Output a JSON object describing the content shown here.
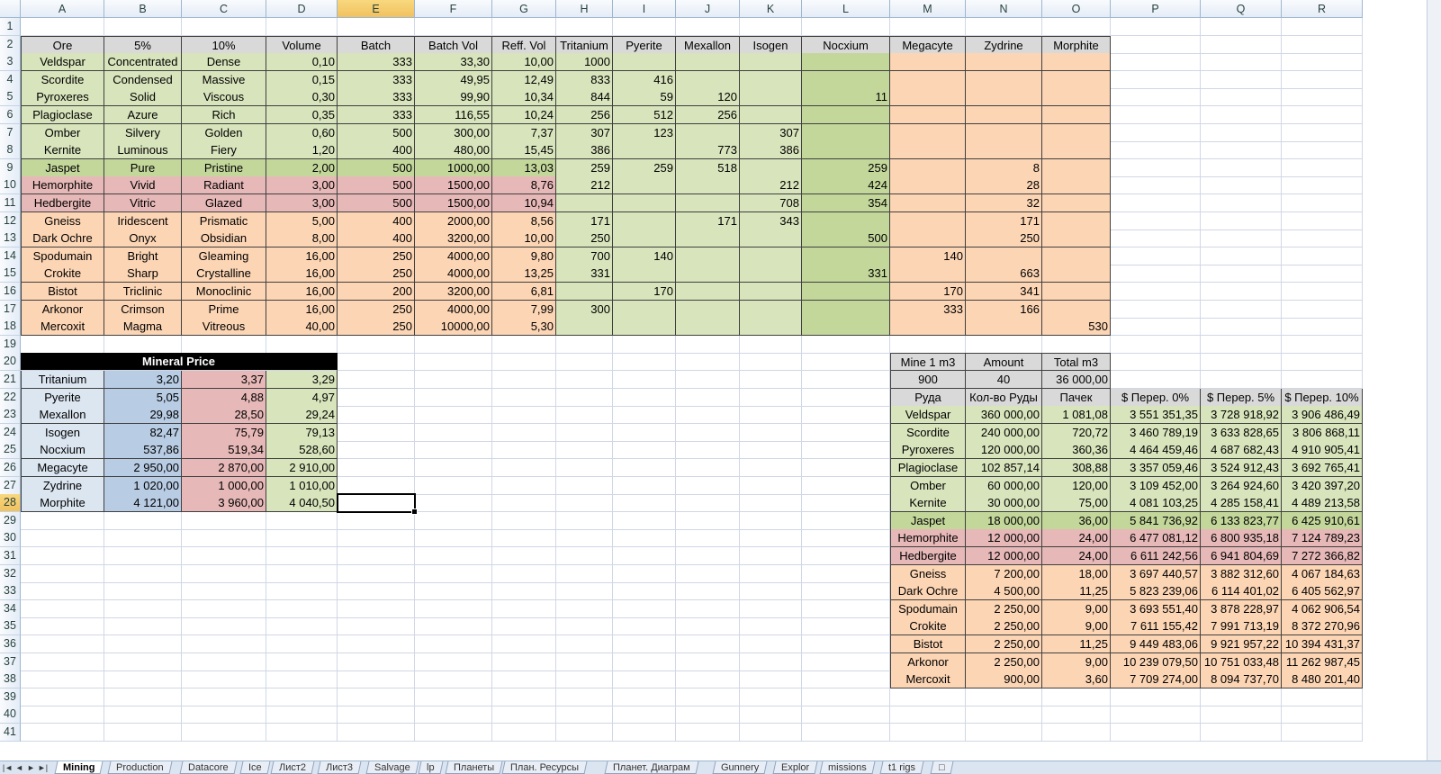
{
  "columns": [
    "A",
    "B",
    "C",
    "D",
    "E",
    "F",
    "G",
    "H",
    "I",
    "J",
    "K",
    "L",
    "M",
    "N",
    "O",
    "P",
    "Q",
    "R"
  ],
  "rows": [
    "1",
    "2",
    "3",
    "4",
    "5",
    "6",
    "7",
    "8",
    "9",
    "10",
    "11",
    "12",
    "13",
    "14",
    "15",
    "16",
    "17",
    "18",
    "19",
    "20",
    "21",
    "22",
    "23",
    "24",
    "25",
    "26",
    "27",
    "28",
    "29",
    "30",
    "31",
    "32",
    "33",
    "34",
    "35",
    "36",
    "37",
    "38",
    "39",
    "40",
    "41"
  ],
  "selected_cell": "E28",
  "colors": {
    "green": "#d8e4bc",
    "green_dark": "#c4d79b",
    "red": "#e6b8b7",
    "orange": "#fcd5b4",
    "header_gray": "#d9d9d9",
    "blue": "#b8cce4",
    "black": "#000000"
  },
  "ore_table": {
    "headers": [
      "Ore",
      "5%",
      "10%",
      "Volume",
      "Batch",
      "Batch Vol",
      "Reff. Vol",
      "Tritanium",
      "Pyerite",
      "Mexallon",
      "Isogen",
      "Nocxium",
      "Megacyte",
      "Zydrine",
      "Morphite"
    ],
    "rows": [
      [
        "Veldspar",
        "Concentrated",
        "Dense",
        "0,10",
        "333",
        "33,30",
        "10,00",
        "1000",
        "",
        "",
        "",
        "",
        "",
        "",
        ""
      ],
      [
        "Scordite",
        "Condensed",
        "Massive",
        "0,15",
        "333",
        "49,95",
        "12,49",
        "833",
        "416",
        "",
        "",
        "",
        "",
        "",
        ""
      ],
      [
        "Pyroxeres",
        "Solid",
        "Viscous",
        "0,30",
        "333",
        "99,90",
        "10,34",
        "844",
        "59",
        "120",
        "",
        "11",
        "",
        "",
        ""
      ],
      [
        "Plagioclase",
        "Azure",
        "Rich",
        "0,35",
        "333",
        "116,55",
        "10,24",
        "256",
        "512",
        "256",
        "",
        "",
        "",
        "",
        ""
      ],
      [
        "Omber",
        "Silvery",
        "Golden",
        "0,60",
        "500",
        "300,00",
        "7,37",
        "307",
        "123",
        "",
        "307",
        "",
        "",
        "",
        ""
      ],
      [
        "Kernite",
        "Luminous",
        "Fiery",
        "1,20",
        "400",
        "480,00",
        "15,45",
        "386",
        "",
        "773",
        "386",
        "",
        "",
        "",
        ""
      ],
      [
        "Jaspet",
        "Pure",
        "Pristine",
        "2,00",
        "500",
        "1000,00",
        "13,03",
        "259",
        "259",
        "518",
        "",
        "259",
        "",
        "8",
        ""
      ],
      [
        "Hemorphite",
        "Vivid",
        "Radiant",
        "3,00",
        "500",
        "1500,00",
        "8,76",
        "212",
        "",
        "",
        "212",
        "424",
        "",
        "28",
        ""
      ],
      [
        "Hedbergite",
        "Vitric",
        "Glazed",
        "3,00",
        "500",
        "1500,00",
        "10,94",
        "",
        "",
        "",
        "708",
        "354",
        "",
        "32",
        ""
      ],
      [
        "Gneiss",
        "Iridescent",
        "Prismatic",
        "5,00",
        "400",
        "2000,00",
        "8,56",
        "171",
        "",
        "171",
        "343",
        "",
        "",
        "171",
        ""
      ],
      [
        "Dark Ochre",
        "Onyx",
        "Obsidian",
        "8,00",
        "400",
        "3200,00",
        "10,00",
        "250",
        "",
        "",
        "",
        "500",
        "",
        "250",
        ""
      ],
      [
        "Spodumain",
        "Bright",
        "Gleaming",
        "16,00",
        "250",
        "4000,00",
        "9,80",
        "700",
        "140",
        "",
        "",
        "",
        "140",
        "",
        ""
      ],
      [
        "Crokite",
        "Sharp",
        "Crystalline",
        "16,00",
        "250",
        "4000,00",
        "13,25",
        "331",
        "",
        "",
        "",
        "331",
        "",
        "663",
        ""
      ],
      [
        "Bistot",
        "Triclinic",
        "Monoclinic",
        "16,00",
        "200",
        "3200,00",
        "6,81",
        "",
        "170",
        "",
        "",
        "",
        "170",
        "341",
        ""
      ],
      [
        "Arkonor",
        "Crimson",
        "Prime",
        "16,00",
        "250",
        "4000,00",
        "7,99",
        "300",
        "",
        "",
        "",
        "",
        "333",
        "166",
        ""
      ],
      [
        "Mercoxit",
        "Magma",
        "Vitreous",
        "40,00",
        "250",
        "10000,00",
        "5,30",
        "",
        "",
        "",
        "",
        "",
        "",
        "",
        "530"
      ]
    ]
  },
  "mineral_price": {
    "title": "Mineral Price",
    "rows": [
      [
        "Tritanium",
        "3,20",
        "3,37",
        "3,29"
      ],
      [
        "Pyerite",
        "5,05",
        "4,88",
        "4,97"
      ],
      [
        "Mexallon",
        "29,98",
        "28,50",
        "29,24"
      ],
      [
        "Isogen",
        "82,47",
        "75,79",
        "79,13"
      ],
      [
        "Nocxium",
        "537,86",
        "519,34",
        "528,60"
      ],
      [
        "Megacyte",
        "2 950,00",
        "2 870,00",
        "2 910,00"
      ],
      [
        "Zydrine",
        "1 020,00",
        "1 000,00",
        "1 010,00"
      ],
      [
        "Morphite",
        "4 121,00",
        "3 960,00",
        "4 040,50"
      ]
    ]
  },
  "mine_table": {
    "headers": [
      "Mine 1 m3",
      "Amount",
      "Total m3"
    ],
    "values": [
      "900",
      "40",
      "36 000,00"
    ]
  },
  "yield_table": {
    "headers": [
      "Руда",
      "Кол-во Руды",
      "Пачек",
      "$ Перер. 0%",
      "$ Перер. 5%",
      "$ Перер. 10%"
    ],
    "rows": [
      [
        "Veldspar",
        "360 000,00",
        "1 081,08",
        "3 551 351,35",
        "3 728 918,92",
        "3 906 486,49"
      ],
      [
        "Scordite",
        "240 000,00",
        "720,72",
        "3 460 789,19",
        "3 633 828,65",
        "3 806 868,11"
      ],
      [
        "Pyroxeres",
        "120 000,00",
        "360,36",
        "4 464 459,46",
        "4 687 682,43",
        "4 910 905,41"
      ],
      [
        "Plagioclase",
        "102 857,14",
        "308,88",
        "3 357 059,46",
        "3 524 912,43",
        "3 692 765,41"
      ],
      [
        "Omber",
        "60 000,00",
        "120,00",
        "3 109 452,00",
        "3 264 924,60",
        "3 420 397,20"
      ],
      [
        "Kernite",
        "30 000,00",
        "75,00",
        "4 081 103,25",
        "4 285 158,41",
        "4 489 213,58"
      ],
      [
        "Jaspet",
        "18 000,00",
        "36,00",
        "5 841 736,92",
        "6 133 823,77",
        "6 425 910,61"
      ],
      [
        "Hemorphite",
        "12 000,00",
        "24,00",
        "6 477 081,12",
        "6 800 935,18",
        "7 124 789,23"
      ],
      [
        "Hedbergite",
        "12 000,00",
        "24,00",
        "6 611 242,56",
        "6 941 804,69",
        "7 272 366,82"
      ],
      [
        "Gneiss",
        "7 200,00",
        "18,00",
        "3 697 440,57",
        "3 882 312,60",
        "4 067 184,63"
      ],
      [
        "Dark Ochre",
        "4 500,00",
        "11,25",
        "5 823 239,06",
        "6 114 401,02",
        "6 405 562,97"
      ],
      [
        "Spodumain",
        "2 250,00",
        "9,00",
        "3 693 551,40",
        "3 878 228,97",
        "4 062 906,54"
      ],
      [
        "Crokite",
        "2 250,00",
        "9,00",
        "7 611 155,42",
        "7 991 713,19",
        "8 372 270,96"
      ],
      [
        "Bistot",
        "2 250,00",
        "11,25",
        "9 449 483,06",
        "9 921 957,22",
        "10 394 431,37"
      ],
      [
        "Arkonor",
        "2 250,00",
        "9,00",
        "10 239 079,50",
        "10 751 033,48",
        "11 262 987,45"
      ],
      [
        "Mercoxit",
        "900,00",
        "3,60",
        "7 709 274,00",
        "8 094 737,70",
        "8 480 201,40"
      ]
    ]
  },
  "sheet_tabs": [
    "Mining",
    "Production",
    "Datacore",
    "Ice",
    "Лист2",
    "Лист3",
    "Salvage",
    "lp",
    "Планеты",
    "План. Ресурсы",
    "Планет. Диаграм",
    "Gunnery",
    "Explor",
    "missions",
    "t1 rigs"
  ],
  "active_tab": "Mining",
  "tab_nav": [
    "first-sheet-icon",
    "prev-sheet-icon",
    "next-sheet-icon",
    "last-sheet-icon"
  ]
}
